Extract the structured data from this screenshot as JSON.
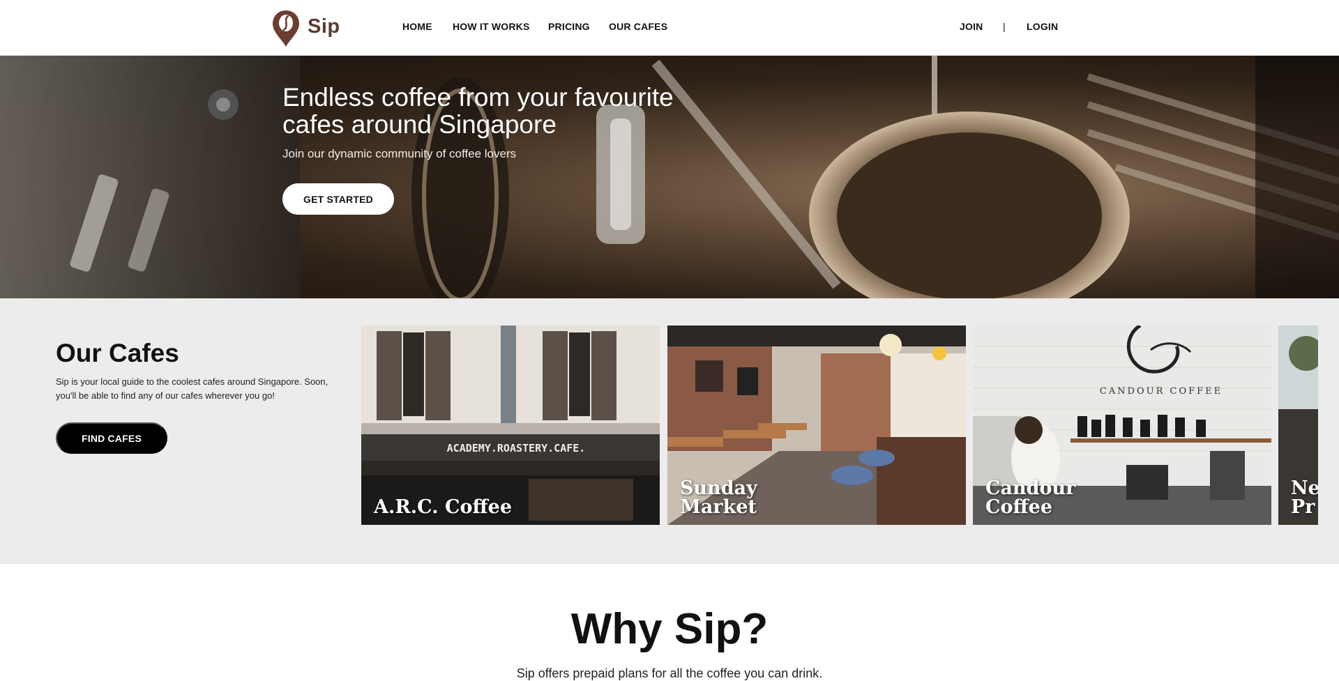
{
  "header": {
    "brand": "Sip",
    "nav": [
      {
        "label": "HOME"
      },
      {
        "label": "HOW IT WORKS"
      },
      {
        "label": "PRICING"
      },
      {
        "label": "OUR CAFES"
      }
    ],
    "join_label": "JOIN",
    "divider": "|",
    "login_label": "LOGIN"
  },
  "hero": {
    "title": "Endless coffee from your favourite cafes around Singapore",
    "subtitle": "Join our dynamic community of coffee lovers",
    "cta_label": "GET STARTED"
  },
  "cafes": {
    "title": "Our Cafes",
    "description": "Sip is your local guide to the coolest cafes around Singapore. Soon, you'll be able to find any of our cafes wherever you go!",
    "cta_label": "FIND CAFES",
    "cards": [
      {
        "name": "A.R.C. Coffee",
        "sign": "ACADEMY.ROASTERY.CAFE."
      },
      {
        "name": "Sunday Market"
      },
      {
        "name": "Candour Coffee",
        "sign": "CANDOUR COFFEE"
      },
      {
        "name": "Neo Pr"
      }
    ]
  },
  "why": {
    "title": "Why Sip?",
    "text": "Sip offers prepaid plans for all the coffee you can drink."
  },
  "colors": {
    "brand": "#5a3b32",
    "cafes_bg": "#ececec",
    "dark_button": "#000000"
  }
}
